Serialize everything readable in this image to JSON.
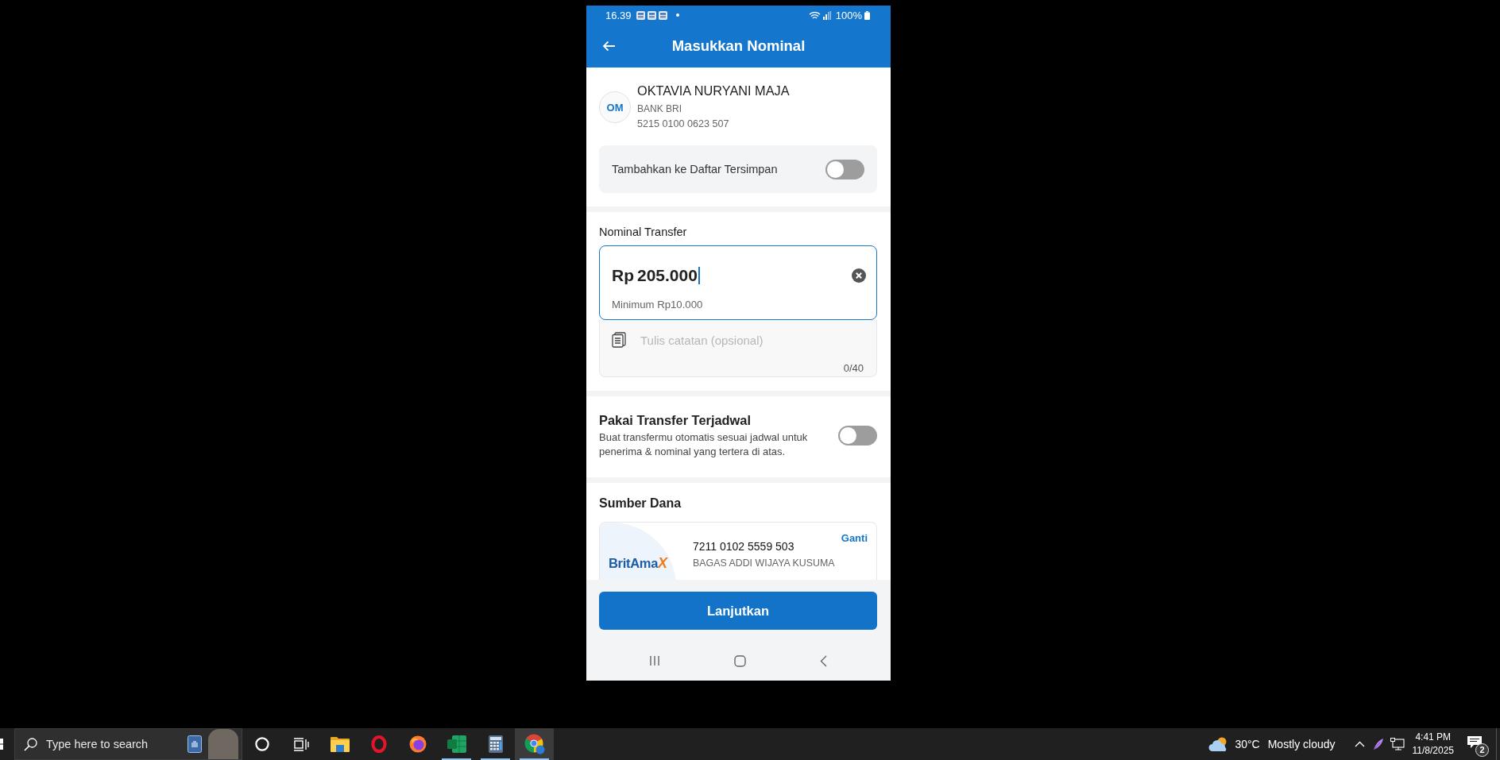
{
  "status_bar": {
    "time": "16.39",
    "notifications": [
      {
        "kind": "app"
      },
      {
        "kind": "app"
      },
      {
        "kind": "app"
      },
      {
        "kind": "dot"
      }
    ],
    "battery": "100%"
  },
  "app_bar": {
    "title": "Masukkan Nominal"
  },
  "recipient": {
    "initials": "OM",
    "name": "OKTAVIA NURYANI MAJA",
    "bank": "BANK BRI",
    "account": "5215 0100 0623 507",
    "save_toggle": {
      "label": "Tambahkan ke Daftar Tersimpan",
      "on": false
    }
  },
  "amount": {
    "label": "Nominal Transfer",
    "prefix": "Rp",
    "value": "205.000",
    "focused": true,
    "hint": "Minimum Rp10.000"
  },
  "note": {
    "placeholder": "Tulis catatan (opsional)",
    "counter": "0/40"
  },
  "schedule": {
    "title": "Pakai Transfer Terjadwal",
    "description": "Buat transfermu otomatis sesuai jadwal untuk penerima & nominal yang tertera di atas.",
    "on": false
  },
  "source": {
    "title": "Sumber Dana",
    "logo": {
      "text": "BritAma",
      "accent": "X"
    },
    "account": "7211 0102 5559 503",
    "holder": "BAGAS ADDI WIJAYA KUSUMA",
    "action": "Ganti"
  },
  "primary_button": {
    "label": "Lanjutkan"
  },
  "nav_bar": [
    {
      "kind": "recents"
    },
    {
      "kind": "home"
    },
    {
      "kind": "back"
    }
  ],
  "taskbar": {
    "search": {
      "placeholder": "Type here to search"
    },
    "apps": [
      {
        "kind": "ring",
        "running": false,
        "selected": false
      },
      {
        "kind": "task-view",
        "running": false,
        "selected": false
      },
      {
        "kind": "folder",
        "running": false,
        "selected": false
      },
      {
        "kind": "oval-ring",
        "running": false,
        "selected": false
      },
      {
        "kind": "flame-globe",
        "running": false,
        "selected": false
      },
      {
        "kind": "sheet",
        "running": true,
        "selected": false
      },
      {
        "kind": "calculator",
        "running": true,
        "selected": false
      },
      {
        "kind": "browser",
        "running": true,
        "selected": true
      }
    ],
    "weather": {
      "temperature": "30°C",
      "condition": "Mostly cloudy"
    },
    "tray": [
      {
        "kind": "chevron"
      },
      {
        "kind": "feather"
      },
      {
        "kind": "network"
      }
    ],
    "clock": {
      "time": "4:41 PM",
      "date": "11/8/2025"
    },
    "notifications": {
      "count": "2"
    }
  }
}
